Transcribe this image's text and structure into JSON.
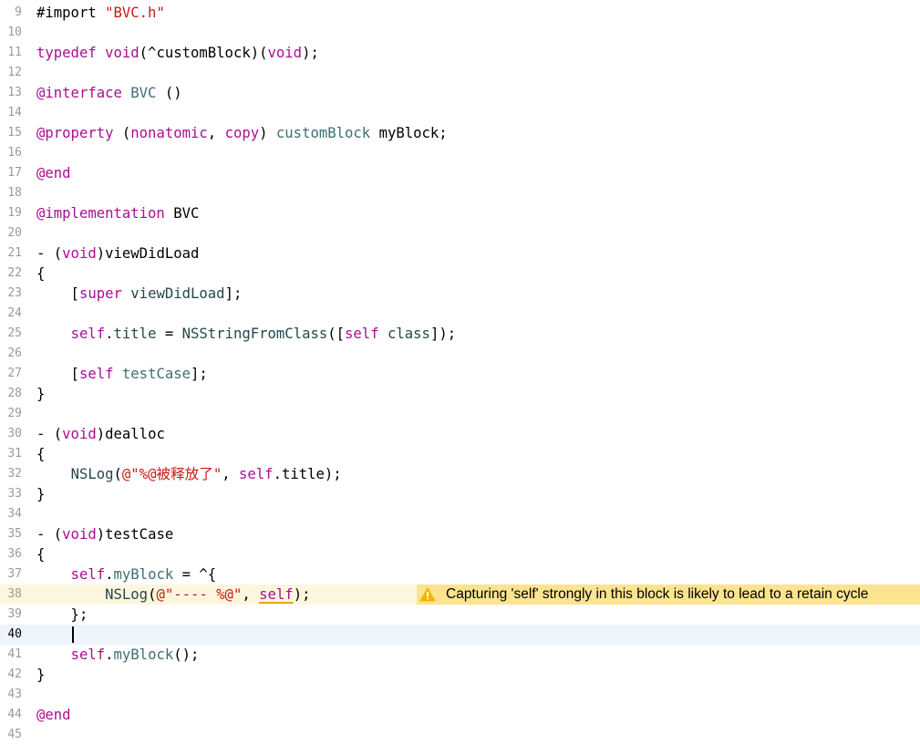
{
  "editor": {
    "lines": [
      {
        "n": "9",
        "tokens": [
          {
            "t": "#import ",
            "c": "plain"
          },
          {
            "t": "\"BVC.h\"",
            "c": "str"
          }
        ]
      },
      {
        "n": "10",
        "tokens": []
      },
      {
        "n": "11",
        "tokens": [
          {
            "t": "typedef",
            "c": "kw"
          },
          {
            "t": " ",
            "c": "plain"
          },
          {
            "t": "void",
            "c": "kw"
          },
          {
            "t": "(^customBlock)(",
            "c": "plain"
          },
          {
            "t": "void",
            "c": "kw"
          },
          {
            "t": ");",
            "c": "plain"
          }
        ]
      },
      {
        "n": "12",
        "tokens": []
      },
      {
        "n": "13",
        "tokens": [
          {
            "t": "@interface",
            "c": "kw"
          },
          {
            "t": " ",
            "c": "plain"
          },
          {
            "t": "BVC",
            "c": "type"
          },
          {
            "t": " ()",
            "c": "plain"
          }
        ]
      },
      {
        "n": "14",
        "tokens": []
      },
      {
        "n": "15",
        "tokens": [
          {
            "t": "@property",
            "c": "kw"
          },
          {
            "t": " (",
            "c": "plain"
          },
          {
            "t": "nonatomic",
            "c": "kw"
          },
          {
            "t": ", ",
            "c": "plain"
          },
          {
            "t": "copy",
            "c": "kw"
          },
          {
            "t": ") ",
            "c": "plain"
          },
          {
            "t": "customBlock",
            "c": "type"
          },
          {
            "t": " myBlock;",
            "c": "plain"
          }
        ]
      },
      {
        "n": "16",
        "tokens": []
      },
      {
        "n": "17",
        "tokens": [
          {
            "t": "@end",
            "c": "kw"
          }
        ]
      },
      {
        "n": "18",
        "tokens": []
      },
      {
        "n": "19",
        "tokens": [
          {
            "t": "@implementation",
            "c": "kw"
          },
          {
            "t": " BVC",
            "c": "plain"
          }
        ]
      },
      {
        "n": "20",
        "tokens": []
      },
      {
        "n": "21",
        "tokens": [
          {
            "t": "- (",
            "c": "plain"
          },
          {
            "t": "void",
            "c": "kw"
          },
          {
            "t": ")viewDidLoad",
            "c": "plain"
          }
        ]
      },
      {
        "n": "22",
        "tokens": [
          {
            "t": "{",
            "c": "plain"
          }
        ]
      },
      {
        "n": "23",
        "tokens": [
          {
            "t": "    [",
            "c": "plain"
          },
          {
            "t": "super",
            "c": "kw"
          },
          {
            "t": " ",
            "c": "plain"
          },
          {
            "t": "viewDidLoad",
            "c": "method"
          },
          {
            "t": "];",
            "c": "plain"
          }
        ]
      },
      {
        "n": "24",
        "tokens": []
      },
      {
        "n": "25",
        "tokens": [
          {
            "t": "    ",
            "c": "plain"
          },
          {
            "t": "self",
            "c": "kw"
          },
          {
            "t": ".",
            "c": "plain"
          },
          {
            "t": "title",
            "c": "method"
          },
          {
            "t": " = ",
            "c": "plain"
          },
          {
            "t": "NSStringFromClass",
            "c": "method"
          },
          {
            "t": "([",
            "c": "plain"
          },
          {
            "t": "self",
            "c": "kw"
          },
          {
            "t": " ",
            "c": "plain"
          },
          {
            "t": "class",
            "c": "method"
          },
          {
            "t": "]);",
            "c": "plain"
          }
        ]
      },
      {
        "n": "26",
        "tokens": []
      },
      {
        "n": "27",
        "tokens": [
          {
            "t": "    [",
            "c": "plain"
          },
          {
            "t": "self",
            "c": "kw"
          },
          {
            "t": " ",
            "c": "plain"
          },
          {
            "t": "testCase",
            "c": "type"
          },
          {
            "t": "];",
            "c": "plain"
          }
        ]
      },
      {
        "n": "28",
        "tokens": [
          {
            "t": "}",
            "c": "plain"
          }
        ]
      },
      {
        "n": "29",
        "tokens": []
      },
      {
        "n": "30",
        "tokens": [
          {
            "t": "- (",
            "c": "plain"
          },
          {
            "t": "void",
            "c": "kw"
          },
          {
            "t": ")dealloc",
            "c": "plain"
          }
        ]
      },
      {
        "n": "31",
        "tokens": [
          {
            "t": "{",
            "c": "plain"
          }
        ]
      },
      {
        "n": "32",
        "tokens": [
          {
            "t": "    ",
            "c": "plain"
          },
          {
            "t": "NSLog",
            "c": "method"
          },
          {
            "t": "(",
            "c": "plain"
          },
          {
            "t": "@\"%@被释放了\"",
            "c": "str"
          },
          {
            "t": ", ",
            "c": "plain"
          },
          {
            "t": "self",
            "c": "kw"
          },
          {
            "t": ".title);",
            "c": "plain"
          }
        ]
      },
      {
        "n": "33",
        "tokens": [
          {
            "t": "}",
            "c": "plain"
          }
        ]
      },
      {
        "n": "34",
        "tokens": []
      },
      {
        "n": "35",
        "tokens": [
          {
            "t": "- (",
            "c": "plain"
          },
          {
            "t": "void",
            "c": "kw"
          },
          {
            "t": ")testCase",
            "c": "plain"
          }
        ]
      },
      {
        "n": "36",
        "tokens": [
          {
            "t": "{",
            "c": "plain"
          }
        ]
      },
      {
        "n": "37",
        "tokens": [
          {
            "t": "    ",
            "c": "plain"
          },
          {
            "t": "self",
            "c": "kw"
          },
          {
            "t": ".",
            "c": "plain"
          },
          {
            "t": "myBlock",
            "c": "type"
          },
          {
            "t": " = ^{",
            "c": "plain"
          }
        ]
      },
      {
        "n": "38",
        "tokens": [
          {
            "t": "        ",
            "c": "plain"
          },
          {
            "t": "NSLog",
            "c": "method"
          },
          {
            "t": "(",
            "c": "plain"
          },
          {
            "t": "@\"---- %@\"",
            "c": "str"
          },
          {
            "t": ", ",
            "c": "plain"
          },
          {
            "t": "self",
            "c": "kw",
            "squiggle": true
          },
          {
            "t": ");",
            "c": "plain"
          }
        ]
      },
      {
        "n": "39",
        "tokens": [
          {
            "t": "    };",
            "c": "plain"
          }
        ]
      },
      {
        "n": "40",
        "tokens": []
      },
      {
        "n": "41",
        "tokens": [
          {
            "t": "    ",
            "c": "plain"
          },
          {
            "t": "self",
            "c": "kw"
          },
          {
            "t": ".",
            "c": "plain"
          },
          {
            "t": "myBlock",
            "c": "type"
          },
          {
            "t": "();",
            "c": "plain"
          }
        ]
      },
      {
        "n": "42",
        "tokens": [
          {
            "t": "}",
            "c": "plain"
          }
        ]
      },
      {
        "n": "43",
        "tokens": []
      },
      {
        "n": "44",
        "tokens": [
          {
            "t": "@end",
            "c": "kw"
          }
        ]
      },
      {
        "n": "45",
        "tokens": []
      }
    ],
    "current_line": "40",
    "warning_line": "38"
  },
  "warning": {
    "message": "Capturing 'self' strongly in this block is likely to lead to a retain cycle",
    "icon": "warning-triangle-icon",
    "banner_color": "#fbe390",
    "icon_color": "#f5b400"
  },
  "colors": {
    "keyword": "#aa0d91",
    "string": "#c41a16",
    "type": "#3f6e74",
    "method": "#26474b",
    "current_line_bg": "#eef4fc",
    "warning_line_bg": "#fdf6de"
  }
}
